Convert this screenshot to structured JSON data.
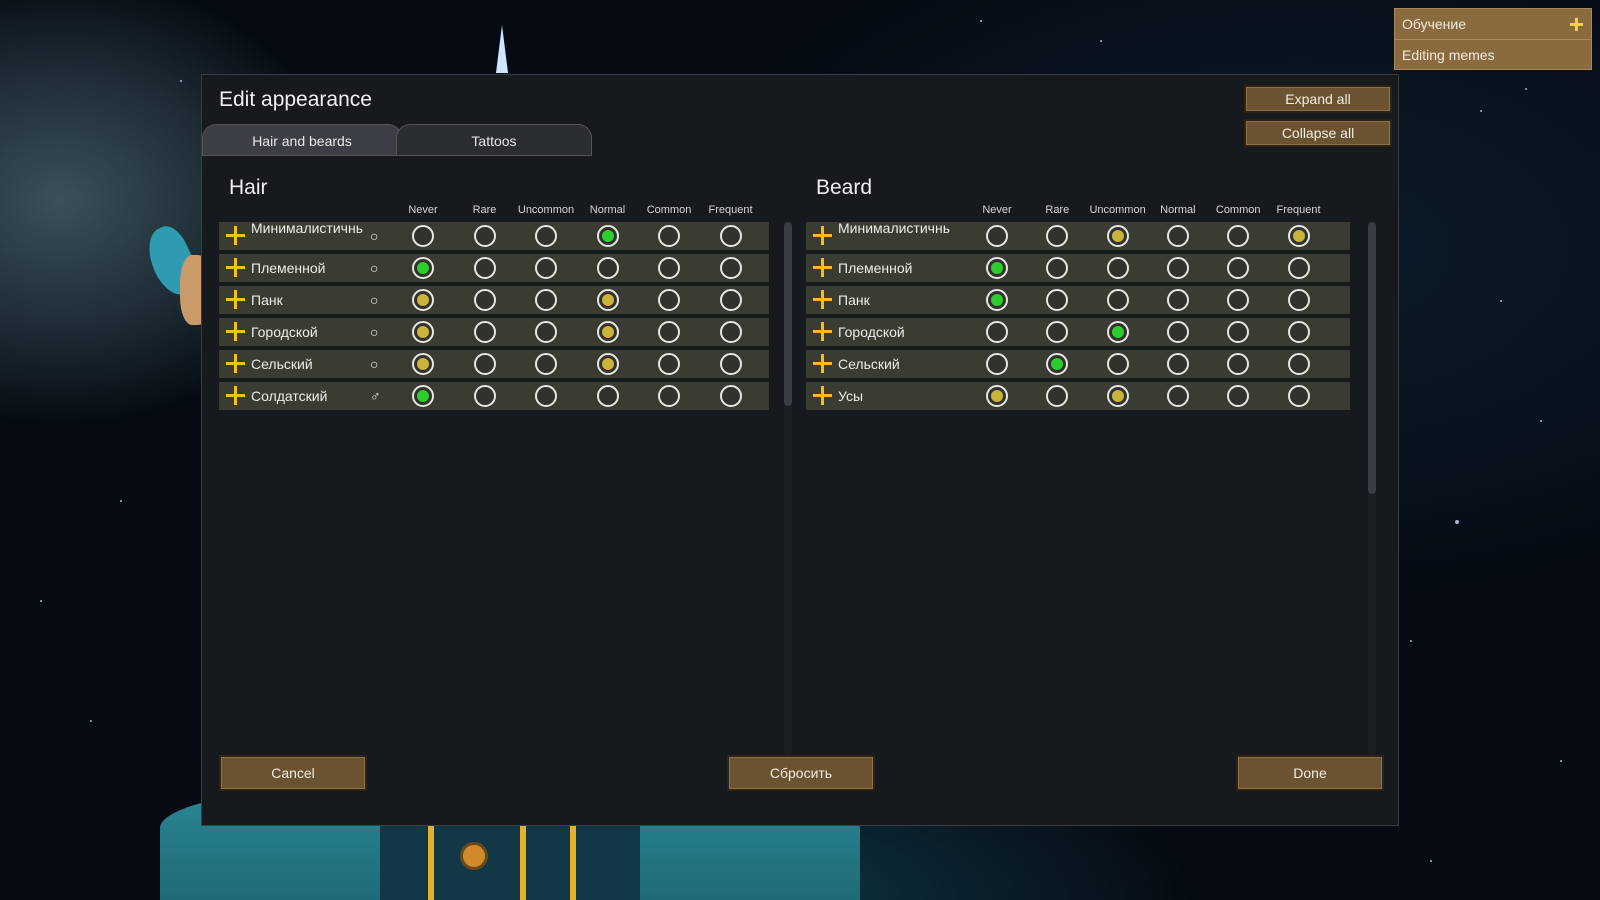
{
  "notifications": [
    {
      "label": "Обучение",
      "icon": "plus-icon"
    },
    {
      "label": "Editing memes"
    }
  ],
  "dialog": {
    "title": "Edit appearance",
    "tabs": [
      {
        "label": "Hair and beards",
        "active": true
      },
      {
        "label": "Tattoos",
        "active": false
      }
    ],
    "expand_all": "Expand all",
    "collapse_all": "Collapse all",
    "cancel": "Cancel",
    "reset": "Сбросить",
    "done": "Done"
  },
  "frequency_levels": [
    "Never",
    "Rare",
    "Uncommon",
    "Normal",
    "Common",
    "Frequent"
  ],
  "colors": {
    "selected": "#2ecc2e",
    "default_marker": "#c8b43a",
    "row_bg": "#3b3c31",
    "button_bg": "#6b5331",
    "plus": "#f0c020"
  },
  "hair": {
    "title": "Hair",
    "rows": [
      {
        "label": "Минималистичный",
        "gender": "○",
        "selected": 3,
        "markers": [
          3
        ]
      },
      {
        "label": "Племенной",
        "gender": "○",
        "selected": 0,
        "markers": []
      },
      {
        "label": "Панк",
        "gender": "○",
        "selected": null,
        "markers": [
          0,
          3
        ]
      },
      {
        "label": "Городской",
        "gender": "○",
        "selected": null,
        "markers": [
          0,
          3
        ]
      },
      {
        "label": "Сельский",
        "gender": "○",
        "selected": null,
        "markers": [
          0,
          3
        ]
      },
      {
        "label": "Солдатский",
        "gender": "♂",
        "selected": 0,
        "markers": []
      }
    ]
  },
  "beard": {
    "title": "Beard",
    "rows": [
      {
        "label": "Минималистичный",
        "selected": null,
        "markers": [
          2,
          5
        ]
      },
      {
        "label": "Племенной",
        "selected": 0,
        "markers": []
      },
      {
        "label": "Панк",
        "selected": 0,
        "markers": []
      },
      {
        "label": "Городской",
        "selected": 2,
        "markers": []
      },
      {
        "label": "Сельский",
        "selected": 1,
        "markers": []
      },
      {
        "label": "Усы",
        "selected": null,
        "markers": [
          0,
          2
        ]
      }
    ]
  }
}
